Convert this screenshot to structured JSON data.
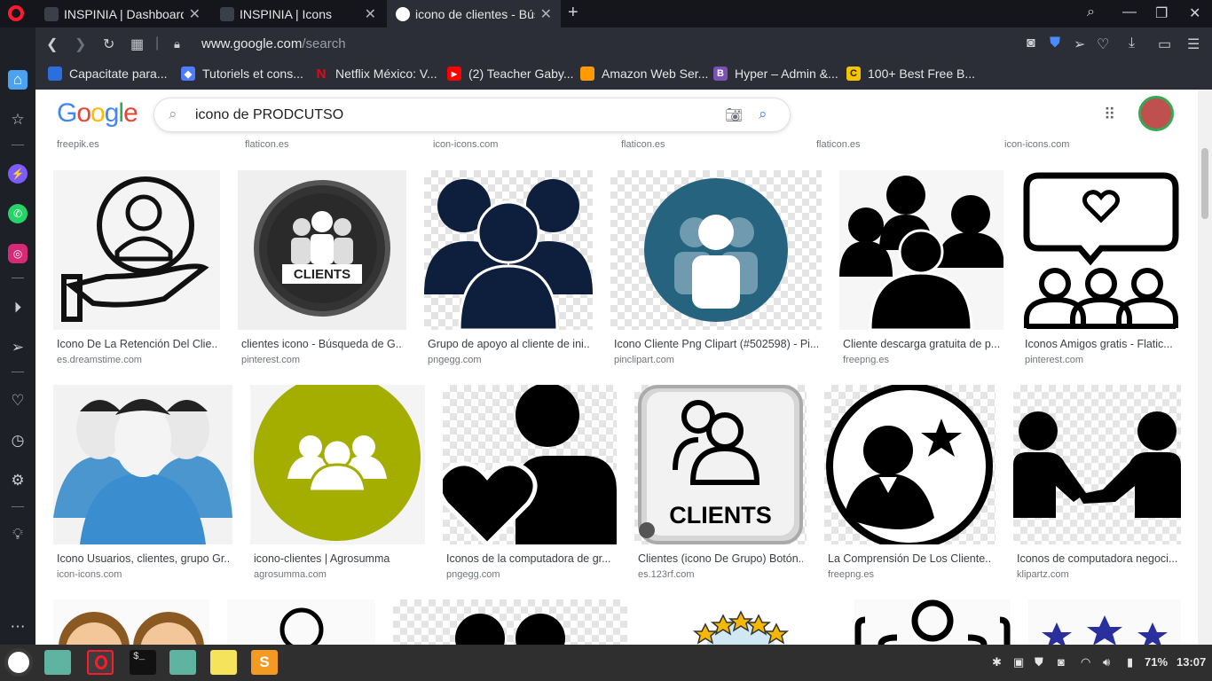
{
  "browser": {
    "tabs": [
      {
        "title": "INSPINIA | Dashboard",
        "active": false
      },
      {
        "title": "INSPINIA | Icons",
        "active": false
      },
      {
        "title": "icono de clientes - Búsqu",
        "active": true
      }
    ],
    "url_host": "www.google.com",
    "url_path": "/search",
    "bookmarks": [
      {
        "label": "Capacitate para...",
        "icon": "globe-icon",
        "color": "#2a6fdb"
      },
      {
        "label": "Tutoriels et cons...",
        "icon": "diamond-icon",
        "color": "#4d7cfe"
      },
      {
        "label": "Netflix México: V...",
        "icon": "netflix-icon",
        "color": "#e50914"
      },
      {
        "label": "(2) Teacher Gaby...",
        "icon": "youtube-icon",
        "color": "#ff0000"
      },
      {
        "label": "Amazon Web Ser...",
        "icon": "aws-cube-icon",
        "color": "#f90"
      },
      {
        "label": "Hyper – Admin &...",
        "icon": "b-icon",
        "color": "#7952b3"
      },
      {
        "label": "100+ Best Free B...",
        "icon": "c-icon",
        "color": "#f4c400"
      }
    ]
  },
  "google": {
    "logo": "Google",
    "query": "icono de PRODCUTSO"
  },
  "top_sources": [
    "freepik.es",
    "flaticon.es",
    "icon-icons.com",
    "flaticon.es",
    "flaticon.es",
    "icon-icons.com"
  ],
  "results_row1": [
    {
      "caption": "Icono De La Retención Del Clie...",
      "source": "es.dreamstime.com"
    },
    {
      "caption": "clientes icono - Búsqueda de G...",
      "source": "pinterest.com"
    },
    {
      "caption": "Grupo de apoyo al cliente de ini...",
      "source": "pngegg.com"
    },
    {
      "caption": "Icono Cliente Png Clipart (#502598) - Pi...",
      "source": "pinclipart.com"
    },
    {
      "caption": "Cliente descarga gratuita de p...",
      "source": "freepng.es"
    },
    {
      "caption": "Iconos Amigos gratis - Flatic...",
      "source": "pinterest.com"
    }
  ],
  "results_row2": [
    {
      "caption": "Icono Usuarios, clientes, grupo Gr...",
      "source": "icon-icons.com"
    },
    {
      "caption": "icono-clientes | Agrosumma",
      "source": "agrosumma.com"
    },
    {
      "caption": "Iconos de la computadora de gr...",
      "source": "pngegg.com"
    },
    {
      "caption": "Clientes (icono De Grupo) Botón...",
      "source": "es.123rf.com"
    },
    {
      "caption": "La Comprensión De Los Cliente...",
      "source": "freepng.es"
    },
    {
      "caption": "Iconos de computadora negoci...",
      "source": "klipartz.com"
    }
  ],
  "image_text": {
    "clients1": "CLIENTS",
    "clients2": "CLIENTS"
  },
  "tray": {
    "battery": "71%",
    "time": "13:07"
  }
}
